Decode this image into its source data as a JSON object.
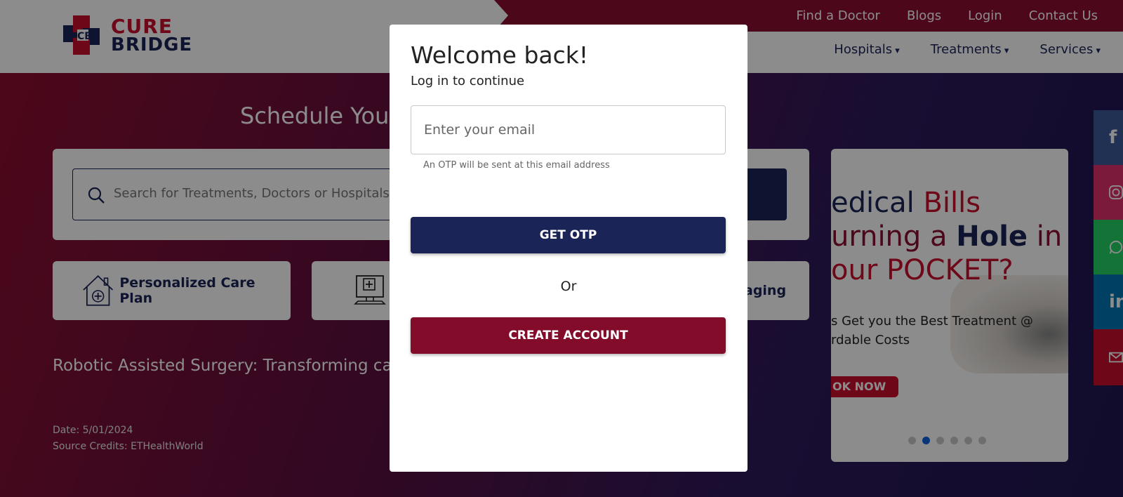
{
  "header": {
    "logo": {
      "line1": "CURE",
      "line2": "BRIDGE"
    },
    "topnav": [
      "Find a Doctor",
      "Blogs",
      "Login",
      "Contact Us"
    ],
    "mainnav": [
      "Hospitals",
      "Treatments",
      "Services"
    ]
  },
  "hero": {
    "title": "Schedule Your",
    "search": {
      "placeholder": "Search for Treatments, Doctors or Hospitals"
    },
    "features": [
      {
        "label": "Personalized Care Plan",
        "icon": "house-plus-icon"
      },
      {
        "label": "",
        "icon": "computer-medical-icon"
      },
      {
        "label": "aging"
      }
    ],
    "article": {
      "title": "Robotic Assisted Surgery: Transforming card",
      "date": "Date: 5/01/2024",
      "source": "Source Credits: ETHealthWorld"
    }
  },
  "banner": {
    "line1_a": "edical ",
    "line1_b": "Bills",
    "line2_a": "urning a ",
    "line2_b": "Hole",
    "line2_c": " in",
    "line3": "our POCKET?",
    "sub1": "s Get you the Best Treatment @",
    "sub2": "rdable Costs",
    "cta": "OK NOW",
    "slide_count": 6,
    "active_slide": 2
  },
  "social": [
    "facebook-icon",
    "instagram-icon",
    "whatsapp-icon",
    "linkedin-icon",
    "mail-icon"
  ],
  "modal": {
    "title": "Welcome back!",
    "subtitle": "Log in to continue",
    "email_placeholder": "Enter your email",
    "email_help": "An OTP will be sent at this email address",
    "get_otp_label": "GET OTP",
    "or_label": "Or",
    "create_account_label": "CREATE ACCOUNT"
  },
  "colors": {
    "navy": "#1a2456",
    "crimson": "#8d0e30",
    "create_btn": "#820c2a",
    "accent_red": "#c8102e"
  }
}
